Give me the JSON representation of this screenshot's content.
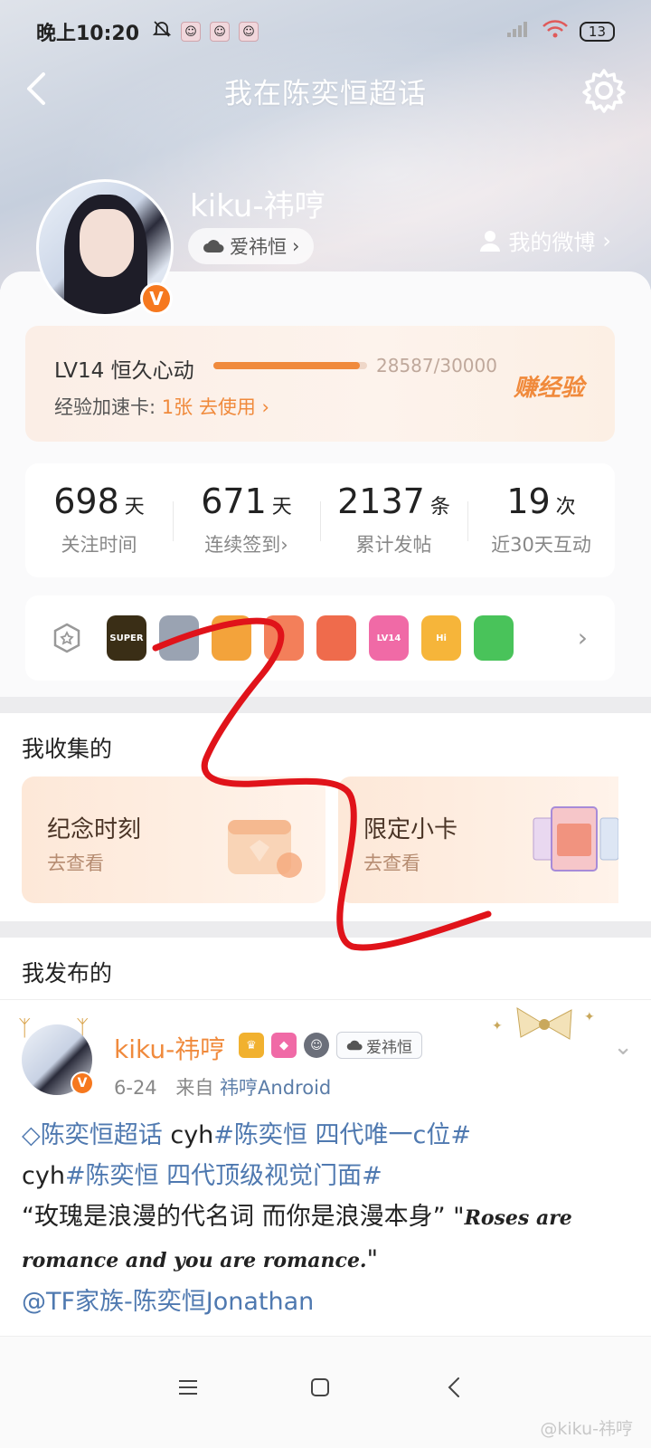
{
  "status_bar": {
    "time": "晚上10:20",
    "battery": "13"
  },
  "topbar": {
    "title": "我在陈奕恒超话"
  },
  "profile": {
    "name": "kiku-祎哼",
    "fan_group": "爱祎恒",
    "my_weibo": "我的微博",
    "verified_mark": "V"
  },
  "level": {
    "name": "LV14  恒久心动",
    "exp": "28587/30000",
    "progress": 0.953,
    "boost_label": "经验加速卡:",
    "boost_count": "1张",
    "boost_action": "去使用",
    "earn": "赚经验"
  },
  "stats": [
    {
      "value": "698",
      "unit": "天",
      "label": "关注时间"
    },
    {
      "value": "671",
      "unit": "天",
      "label": "连续签到"
    },
    {
      "value": "2137",
      "unit": "条",
      "label": "累计发帖"
    },
    {
      "value": "19",
      "unit": "次",
      "label": "近30天互动"
    }
  ],
  "badges": [
    {
      "text": "SUPER",
      "color": "#3a2e16"
    },
    {
      "text": "",
      "color": "#9aa3b2"
    },
    {
      "text": "",
      "color": "#f3a33b"
    },
    {
      "text": "",
      "color": "#f37f5a"
    },
    {
      "text": "",
      "color": "#ef6b4c"
    },
    {
      "text": "LV14",
      "color": "#f06aa6"
    },
    {
      "text": "Hi",
      "color": "#f6b53a"
    },
    {
      "text": "",
      "color": "#49c35a"
    }
  ],
  "collect": {
    "title": "我收集的",
    "items": [
      {
        "title": "纪念时刻",
        "sub": "去查看"
      },
      {
        "title": "限定小卡",
        "sub": "去查看"
      }
    ]
  },
  "posts": {
    "title": "我发布的",
    "author": "kiku-祎哼",
    "fan_tag": "爱祎恒",
    "date": "6-24",
    "from": "来自",
    "source": "祎哼Android",
    "body": {
      "topic1": "陈奕恒超话",
      "seg1": "  cyh",
      "topic2": "#陈奕恒 四代唯一c位#",
      "seg2": "cyh",
      "topic3": "#陈奕恒 四代顶级视觉门面#",
      "quote": "“玫瑰是浪漫的代名词 而你是浪漫本身” \"",
      "script": "Roses are romance and you are romance.",
      "script_end": "\"",
      "mention": "@TF家族-陈奕恒Jonathan"
    }
  },
  "watermark": "@kiku-祎哼"
}
